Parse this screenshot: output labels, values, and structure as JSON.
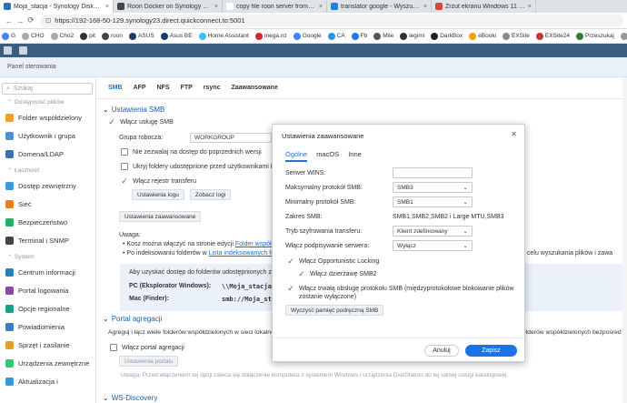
{
  "browser": {
    "tabs": [
      {
        "label": "Moja_stacja - Synology DiskStation",
        "color": "#2e6fbd",
        "active": true
      },
      {
        "label": "Roon Docker on Synology NAS no",
        "color": "#444444",
        "active": false
      },
      {
        "label": "copy file roon server from synolog",
        "color": "#ffffff",
        "active": false
      },
      {
        "label": "translator google - Wyszukaj",
        "color": "#2680d9",
        "active": false
      },
      {
        "label": "Zrzut ekranu Windows 11 - skróty",
        "color": "#d04a3a",
        "active": false
      }
    ],
    "url": "https://192-168-50-129.synology23.direct.quickconnect.to:5001",
    "bookmarks": [
      {
        "label": "G",
        "color": "#4285f4"
      },
      {
        "label": "CHO",
        "color": "#aaaaaa"
      },
      {
        "label": "Cho2",
        "color": "#aaaaaa"
      },
      {
        "label": "pit",
        "color": "#333333"
      },
      {
        "label": "roon",
        "color": "#444444"
      },
      {
        "label": "ASUS",
        "color": "#1b3c6d"
      },
      {
        "label": "Asus BE",
        "color": "#1b3c6d"
      },
      {
        "label": "Home Assistant",
        "color": "#41bdf5"
      },
      {
        "label": "mega.nz",
        "color": "#d9272e"
      },
      {
        "label": "Google",
        "color": "#4285f4"
      },
      {
        "label": "CA",
        "color": "#2196f3"
      },
      {
        "label": "Fb",
        "color": "#1877f2"
      },
      {
        "label": "Mile",
        "color": "#555555"
      },
      {
        "label": "legimi",
        "color": "#333333"
      },
      {
        "label": "DarkBox",
        "color": "#222222"
      },
      {
        "label": "eBooki",
        "color": "#f4a100"
      },
      {
        "label": "EXSite",
        "color": "#888888"
      },
      {
        "label": "EXSite24",
        "color": "#c0392b"
      },
      {
        "label": "Przeszukaj",
        "color": "#2e7d32"
      },
      {
        "label": "pijafk",
        "color": "#999999"
      }
    ]
  },
  "panel": {
    "title": "Panel sterowania"
  },
  "sidebar": {
    "search_placeholder": "Szukaj",
    "section1": "Dostępność plików",
    "items1": [
      {
        "label": "Folder współdzielony",
        "color": "#f0a020"
      },
      {
        "label": "Usługi plików",
        "color": "#2f80d0"
      },
      {
        "label": "Użytkownik i grupa",
        "color": "#4a90d9"
      },
      {
        "label": "Domena/LDAP",
        "color": "#3b6fb0"
      }
    ],
    "section2": "Łączność",
    "items2": [
      {
        "label": "Dostęp zewnętrzny",
        "color": "#3a9ad9"
      },
      {
        "label": "Sieć",
        "color": "#e67e22"
      },
      {
        "label": "Bezpieczeństwo",
        "color": "#27ae60"
      },
      {
        "label": "Terminal i SNMP",
        "color": "#444444"
      }
    ],
    "section3": "System",
    "items3": [
      {
        "label": "Centrum informacji",
        "color": "#2980b9"
      },
      {
        "label": "Portal logowania",
        "color": "#8e44ad"
      },
      {
        "label": "Opcje regionalne",
        "color": "#16a085"
      },
      {
        "label": "Powiadomienia",
        "color": "#2c81c9"
      },
      {
        "label": "Sprzęt i zasilanie",
        "color": "#e0a020"
      },
      {
        "label": "Urządzenia zewnętrzne",
        "color": "#2ecc71"
      },
      {
        "label": "Aktualizacja i",
        "color": "#3498db"
      }
    ]
  },
  "main": {
    "tabs": [
      "SMB",
      "AFP",
      "NFS",
      "FTP",
      "rsync",
      "Zaawansowane"
    ],
    "smb_header": "Ustawienia SMB",
    "enable_smb": "Włącz usługę SMB",
    "workgroup_label": "Grupa robocza:",
    "workgroup_value": "WORKGROUP",
    "opt1": "Nie zezwalaj na dostęp do poprzednich wersji",
    "opt2": "Ukryj foldery udostępnione przed użytkownikami bez",
    "opt3": "Włącz rejestr transferu",
    "btn_log_settings": "Ustawienia logu",
    "btn_show_logs": "Zobacz logi",
    "btn_advanced": "Ustawienia zaawansowane",
    "note_title": "Uwaga:",
    "note1": "Kosz można włączyć na stronie edycji",
    "note1_link": "Folder współdz",
    "note2": "Po indeksowaniu folderów w",
    "note2_link": "Lista indeksowanych folder",
    "note2_tail": "w celu wyszukania plików i zawa",
    "info_text": "Aby uzyskać dostęp do folderów udostępnionych z k",
    "pc_label": "PC (Eksplorator Windows):",
    "pc_value": "\\\\Moja_stacja",
    "mac_label": "Mac (Finder):",
    "mac_value": "smb://Moja_sta",
    "portal_header": "Portal agregacji",
    "portal_text": "Agreguj i łącz wiele folderów współdzielonych w sieci lokalne",
    "portal_tail": "folderów współdzielonych bezpośred",
    "portal_enable": "Włącz portal agregacji",
    "btn_portal_settings": "Ustawienia portalu",
    "portal_warning": "Uwaga: Przed włączeniem tej opcji zaleca się dołączenie komputera z systemem Windows i urządzenia DiskStation do tej samej usługi katalogowej.",
    "ws_header": "WS-Discovery"
  },
  "modal": {
    "title": "Ustawienia zaawansowane",
    "tabs": [
      "Ogólne",
      "macOS",
      "Inne"
    ],
    "wins_label": "Serwer WINS:",
    "wins_value": "",
    "max_proto_label": "Maksymalny protokół SMB:",
    "max_proto_value": "SMB3",
    "min_proto_label": "Minimalny protokół SMB:",
    "min_proto_value": "SMB1",
    "range_label": "Zakres SMB:",
    "range_value": "SMB1,SMB2,SMB2 i Large MTU,SMB3",
    "enc_label": "Tryb szyfrowania transferu:",
    "enc_value": "Klient zdefiniowany",
    "sign_label": "Włącz podpisywanie serwera:",
    "sign_value": "Wyłącz",
    "oplock": "Włącz Opportunistic Locking",
    "oplock2": "Włącz dzierżawę SMB2",
    "durable1": "Włącz trwałą obsługę protokołu SMB (międzyprotokołowe blokowanie plików",
    "durable2": "zostanie wyłączone)",
    "clear_cache": "Wyczyść pamięć podręczną SMB",
    "cancel": "Anuluj",
    "save": "Zapisz"
  }
}
